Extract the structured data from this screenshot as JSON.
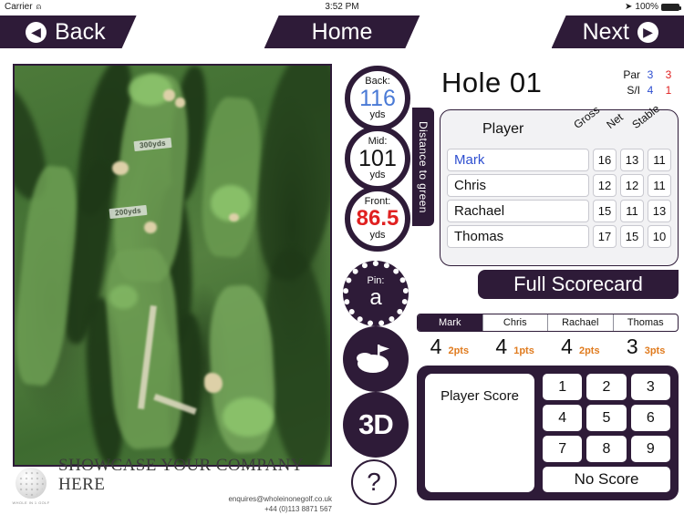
{
  "status_bar": {
    "carrier": "Carrier",
    "wifi_icon": "wifi-icon",
    "time": "3:52 PM",
    "location_icon": "location-arrow-icon",
    "battery": "100%"
  },
  "nav": {
    "back": "Back",
    "home": "Home",
    "next": "Next",
    "back_icon": "chevron-left-circle-icon",
    "next_icon": "chevron-right-circle-icon"
  },
  "map": {
    "markers": [
      {
        "label": "300yds"
      },
      {
        "label": "200yds"
      }
    ]
  },
  "distances": {
    "tab_label": "Distance to green",
    "items": [
      {
        "label": "Back:",
        "value": "116",
        "unit": "yds",
        "color": "#4a7ad6"
      },
      {
        "label": "Mid:",
        "value": "101",
        "unit": "yds",
        "color": "#111111"
      },
      {
        "label": "Front:",
        "value": "86.5",
        "unit": "yds",
        "color": "#e02020"
      }
    ]
  },
  "pin": {
    "label": "Pin:",
    "value": "a"
  },
  "tools": {
    "green_icon": "green-with-flag-icon",
    "three_d": "3D",
    "help": "?"
  },
  "hole": {
    "title": "Hole 01",
    "par_label": "Par",
    "par_blue": "3",
    "par_red": "3",
    "si_label": "S/I",
    "si_blue": "4",
    "si_red": "1"
  },
  "scorecard": {
    "headers": {
      "player": "Player",
      "gross": "Gross",
      "net": "Net",
      "stable": "Stable"
    },
    "rows": [
      {
        "name": "Mark",
        "gross": "16",
        "net": "13",
        "stable": "11",
        "selected": true
      },
      {
        "name": "Chris",
        "gross": "12",
        "net": "12",
        "stable": "11",
        "selected": false
      },
      {
        "name": "Rachael",
        "gross": "15",
        "net": "11",
        "stable": "13",
        "selected": false
      },
      {
        "name": "Thomas",
        "gross": "17",
        "net": "15",
        "stable": "10",
        "selected": false
      }
    ],
    "full_scorecard_label": "Full Scorecard"
  },
  "player_tabs": [
    {
      "label": "Mark",
      "active": true
    },
    {
      "label": "Chris",
      "active": false
    },
    {
      "label": "Rachael",
      "active": false
    },
    {
      "label": "Thomas",
      "active": false
    }
  ],
  "points_row": [
    {
      "score": "4",
      "points": "2pts"
    },
    {
      "score": "4",
      "points": "1pts"
    },
    {
      "score": "4",
      "points": "2pts"
    },
    {
      "score": "3",
      "points": "3pts"
    }
  ],
  "keypad": {
    "player_score_label": "Player Score",
    "keys": [
      [
        "1",
        "2",
        "3"
      ],
      [
        "4",
        "5",
        "6"
      ],
      [
        "7",
        "8",
        "9"
      ]
    ],
    "no_score_label": "No Score"
  },
  "advert": {
    "logo_tag": "WHOLE IN 1 GOLF",
    "title": "SHOWCASE YOUR COMPANY HERE",
    "email": "enquires@wholeinonegolf.co.uk",
    "phone": "+44 (0)113 8871 567"
  },
  "colors": {
    "brand_purple": "#2e1b38",
    "accent_orange": "#e07b1e",
    "blue": "#2e4fd0",
    "red": "#e02020"
  }
}
